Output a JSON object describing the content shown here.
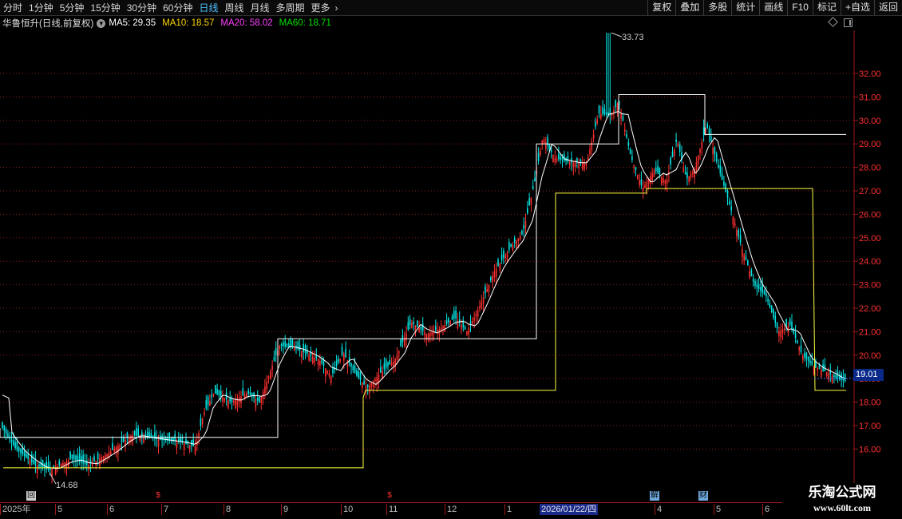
{
  "toolbar": {
    "tabs": [
      {
        "label": "分时",
        "active": false
      },
      {
        "label": "1分钟",
        "active": false
      },
      {
        "label": "5分钟",
        "active": false
      },
      {
        "label": "15分钟",
        "active": false
      },
      {
        "label": "30分钟",
        "active": false
      },
      {
        "label": "60分钟",
        "active": false
      },
      {
        "label": "日线",
        "active": true
      },
      {
        "label": "周线",
        "active": false
      },
      {
        "label": "月线",
        "active": false
      },
      {
        "label": "多周期",
        "active": false
      },
      {
        "label": "更多",
        "active": false
      }
    ],
    "buttons": [
      "复权",
      "叠加",
      "多股",
      "统计",
      "画线",
      "F10",
      "标记",
      "+自选",
      "返回"
    ]
  },
  "info": {
    "title": "华鲁恒升(日线,前复权)",
    "ma": [
      {
        "label": "MA5: 29.35",
        "color": "#ffffff"
      },
      {
        "label": "MA10: 18.57",
        "color": "#ffd700"
      },
      {
        "label": "MA20: 58.02",
        "color": "#ff40ff"
      },
      {
        "label": "MA60: 18.71",
        "color": "#00e000"
      }
    ]
  },
  "chart": {
    "high_label": "33.73",
    "low_label": "14.68",
    "current_price": "19.01",
    "price_axis": [
      "32.00",
      "31.00",
      "30.00",
      "29.00",
      "28.00",
      "27.00",
      "26.00",
      "25.00",
      "24.00",
      "23.00",
      "22.00",
      "21.00",
      "20.00",
      "19.00",
      "18.00",
      "17.00",
      "16.00"
    ],
    "colors": {
      "up": "#ff3030",
      "down": "#00e5e5",
      "ma_white": "#ffffff",
      "ma_yellow": "#ffff40",
      "grid": "#8b1a1a"
    }
  },
  "date_axis": {
    "labels": [
      "2025年",
      "5",
      "6",
      "7",
      "8",
      "9",
      "10",
      "11",
      "12",
      "1",
      "4",
      "5",
      "6"
    ],
    "cursor_date": "2026/01/22/四"
  },
  "events": [
    "回",
    "$",
    "$",
    "解",
    "财"
  ],
  "watermark": {
    "line1": "乐淘公式网",
    "line2": "www.60lt.com"
  }
}
